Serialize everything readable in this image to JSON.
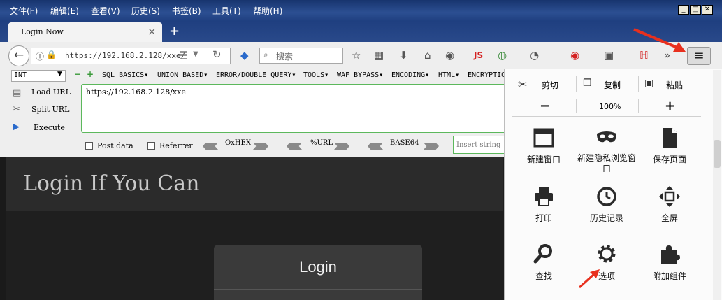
{
  "menubar": {
    "items": [
      "文件(F)",
      "编辑(E)",
      "查看(V)",
      "历史(S)",
      "书签(B)",
      "工具(T)",
      "帮助(H)"
    ]
  },
  "tab": {
    "title": "Login Now",
    "close": "×",
    "new_tab": "+"
  },
  "navbar": {
    "url": "https://192.168.2.128/xxe/",
    "search_placeholder": "搜索",
    "js_label": "JS"
  },
  "hackbar": {
    "select_value": "INT",
    "menus": [
      "SQL BASICS▾",
      "UNION BASED▾",
      "ERROR/DOUBLE QUERY▾",
      "TOOLS▾",
      "WAF BYPASS▾",
      "ENCODING▾",
      "HTML▾",
      "ENCRYPTION▾"
    ],
    "load_url": "Load URL",
    "split_url": "Split URL",
    "execute": "Execute",
    "url_value": "https://192.168.2.128/xxe",
    "post_data": "Post data",
    "referrer": "Referrer",
    "oxhex": "OxHEX",
    "url_enc": "%URL",
    "base64": "BASE64",
    "insert_placeholder": "Insert string"
  },
  "page": {
    "heading": "Login If You Can",
    "box_title": "Login"
  },
  "panel": {
    "cut": "剪切",
    "copy": "复制",
    "paste": "粘贴",
    "zoom_out": "−",
    "zoom": "100%",
    "zoom_in": "+",
    "new_window": "新建窗口",
    "private_window": "新建隐私浏览窗口",
    "save_page": "保存页面",
    "print": "打印",
    "history": "历史记录",
    "fullscreen": "全屏",
    "find": "查找",
    "options": "选项",
    "addons": "附加组件"
  },
  "colors": {
    "title_blue": "#2c4f92",
    "accent_red": "#e8301e",
    "hackbar_green": "#5cb85c",
    "dark_bg": "#2b2b2b"
  }
}
